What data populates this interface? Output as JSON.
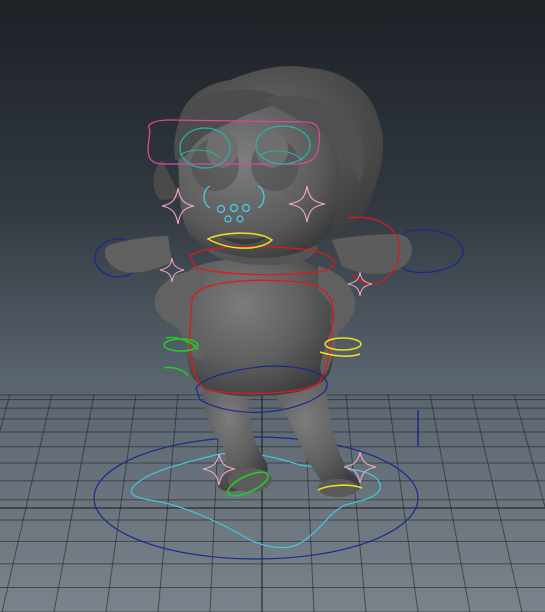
{
  "viewport": {
    "panel": "perspective-viewport",
    "background_gradient": [
      "#1c2126",
      "#333a42",
      "#5a646e",
      "#7a838b"
    ],
    "grid_color": "#1a1d20",
    "grid_axis_color": "#0c0e10"
  },
  "character": {
    "mesh_color": "#6a6a6a",
    "mesh_shadow": "#3f3f3f",
    "mesh_highlight": "#8a8a8a"
  },
  "rig_controls": {
    "colors": {
      "root_outer": "#1a2a8c",
      "root_inner": "#46c6e0",
      "body_main": "#e01818",
      "face": "#d84a9a",
      "eyes": "#2ab0a6",
      "nose": "#4ad0f0",
      "mouth": "#f0e020",
      "sparkles": "#f0a8c8",
      "hands_left": "#22cc22",
      "hands_right": "#f0e020",
      "feet_left": "#22cc22",
      "feet_right": "#f0e020",
      "ears": "#1a2a8c"
    },
    "items": [
      "root-control",
      "root-inner-control",
      "hip-control",
      "chest-control",
      "neck-control",
      "head-control",
      "eye-left-control",
      "eye-right-control",
      "nose-control",
      "mouth-control",
      "ear-left-control",
      "ear-right-control",
      "cheek-left-sparkle",
      "cheek-right-sparkle",
      "hand-left-control",
      "hand-right-control",
      "foot-left-control",
      "foot-right-control",
      "foot-left-sparkle",
      "foot-right-sparkle",
      "pole-vector-control"
    ]
  }
}
